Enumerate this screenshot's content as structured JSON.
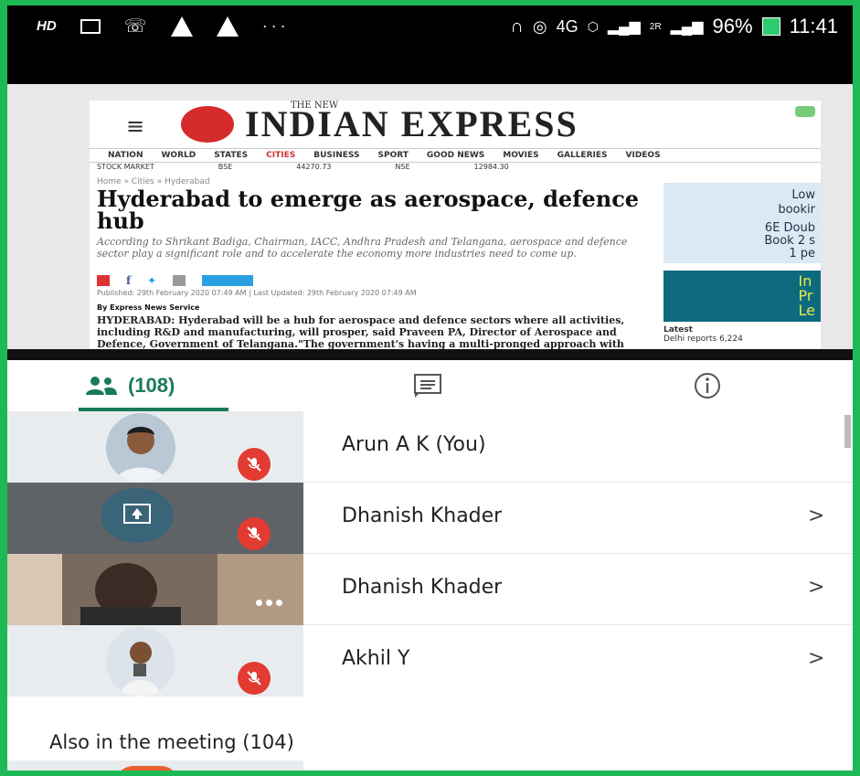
{
  "status_bar": {
    "hd": "HD",
    "network": "4G",
    "battery": "96%",
    "time": "11:41",
    "signal_label": "2R",
    "battery_icon": "battery-charging-icon",
    "overflow": "···"
  },
  "shared_screen": {
    "paper_name": "INDIAN EXPRESS",
    "paper_prefix": "THE NEW",
    "nav_items": [
      "NATION",
      "WORLD",
      "STATES",
      "CITIES",
      "BUSINESS",
      "SPORT",
      "GOOD NEWS",
      "MOVIES",
      "GALLERIES",
      "VIDEOS"
    ],
    "ticker": [
      "STOCK MARKET",
      "BSE",
      "44270.73",
      "NSE",
      "12984.30"
    ],
    "breadcrumb": "Home » Cities » Hyderabad",
    "headline": "Hyderabad to emerge as aerospace, defence hub",
    "standfirst": "According to Shrikant Badiga, Chairman, IACC, Andhra Pradesh and Telangana, aerospace and defence sector play a significant role and to accelerate the economy more industries need to come up.",
    "published": "Published: 29th February 2020 07:49 AM  |  Last Updated: 29th February 2020 07:49 AM",
    "byline": "By Express News Service",
    "body": "HYDERABAD: Hyderabad will be a hub for aerospace and defence sectors where all activities, including R&D and manufacturing, will prosper, said Praveen PA, Director of Aerospace and Defence, Government of Telangana.\"The government's having a multi-pronged approach with tie-ups with universities to set up need-based education programmes, setting up of centres of excellence and promoting a lot of",
    "ad1_lines": [
      "Low",
      "bookir",
      "6E Doub",
      "Book 2 s",
      "1 pe"
    ],
    "ad2_text": "In\nPr\nLe",
    "latest": "Latest",
    "latest_item": "Delhi reports 6,224"
  },
  "tabs": {
    "people_count": "(108)",
    "people_icon": "people-icon",
    "chat_icon": "chat-icon",
    "info_icon": "info-icon"
  },
  "participants": [
    {
      "name": "Arun A K (You)",
      "muted": true,
      "chevron": ""
    },
    {
      "name": "Dhanish Khader",
      "muted": true,
      "chevron": ">"
    },
    {
      "name": "Dhanish Khader",
      "muted": false,
      "chevron": ">"
    },
    {
      "name": "Akhil Y",
      "muted": true,
      "chevron": ">"
    }
  ],
  "also_in_meeting": "Also in the meeting (104)",
  "colors": {
    "accent": "#1a7a5a",
    "mute_red": "#e23b32",
    "border_green": "#1db954"
  }
}
